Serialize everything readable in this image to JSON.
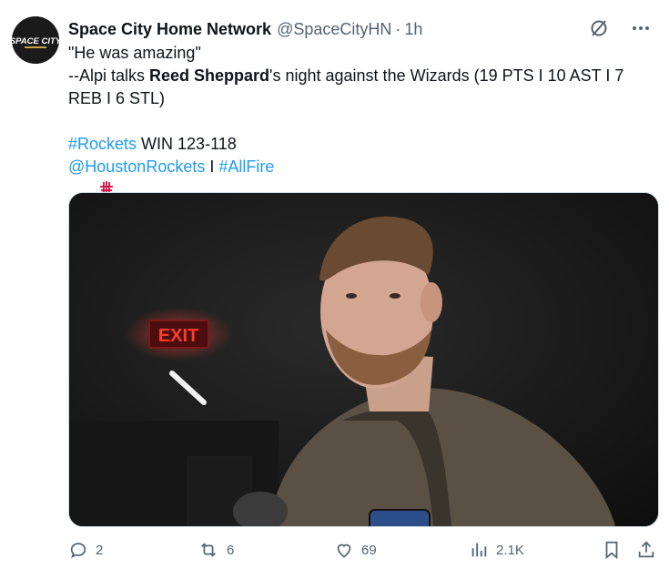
{
  "tweet": {
    "author_name": "Space City Home Network",
    "handle": "@SpaceCityHN",
    "separator": "·",
    "time": "1h",
    "avatar_text": "SPACE CITY",
    "text": {
      "line1": "\"He was amazing\"",
      "line2_prefix": "--Alpi talks ",
      "line2_bold": "Reed Sheppard",
      "line2_suffix": "'s night against the Wizards (19 PTS I 10 AST I 7",
      "line3": "REB I 6 STL)",
      "hashtag_rockets": "#Rockets",
      "win_text": " WIN 123-118",
      "mention": "@HoustonRockets",
      "divider": " I ",
      "hashtag_allfire": "#AllFire"
    },
    "media": {
      "exit_sign": "EXIT"
    },
    "actions": {
      "replies": "2",
      "reposts": "6",
      "likes": "69",
      "views": "2.1K"
    }
  },
  "colors": {
    "link": "#1d9bf0",
    "muted": "#536471",
    "text": "#0f1419",
    "rockets_red": "#ce1141"
  }
}
